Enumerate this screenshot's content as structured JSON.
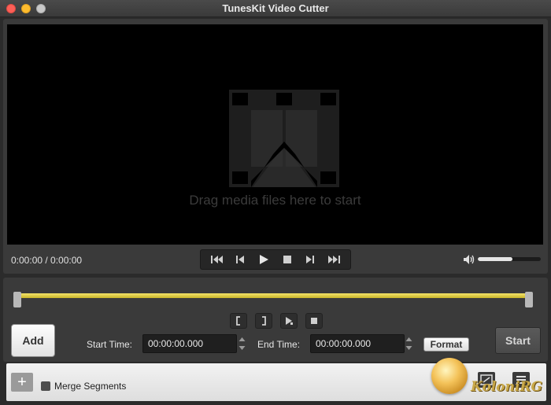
{
  "window": {
    "title": "TunesKit Video Cutter"
  },
  "player": {
    "drag_hint": "Drag media files here to start",
    "time_display": "0:00:00 / 0:00:00",
    "volume_level": 0.55
  },
  "controls": {
    "add_label": "Add",
    "start_time_label": "Start Time:",
    "start_time_value": "00:00:00.000",
    "end_time_label": "End Time:",
    "end_time_value": "00:00:00.000",
    "format_label": "Format",
    "start_label": "Start"
  },
  "list": {
    "merge_label": "Merge Segments",
    "add_symbol": "+"
  },
  "watermark": {
    "text": "KoloniRG"
  },
  "colors": {
    "timeline": "#f4e46a",
    "background": "#2b2b2b",
    "video": "#000000"
  }
}
